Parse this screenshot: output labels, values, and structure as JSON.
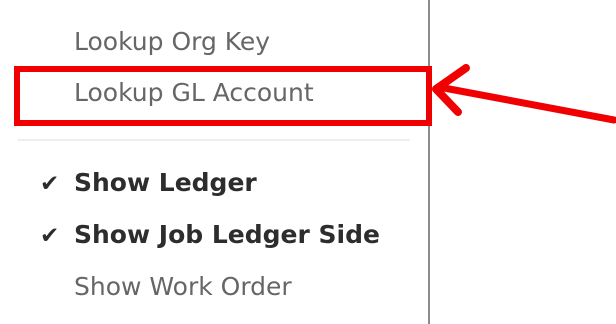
{
  "menu": {
    "items": [
      {
        "label": "Lookup Org Key",
        "checked": false
      },
      {
        "label": "Lookup GL Account",
        "checked": false,
        "highlighted": true
      },
      {
        "label": "Show Ledger",
        "checked": true
      },
      {
        "label": "Show Job Ledger Side",
        "checked": true
      },
      {
        "label": "Show Work Order",
        "checked": false
      }
    ],
    "check_mark": "✔"
  },
  "annotation": {
    "highlight_color": "#f00000",
    "arrow_color": "#f00000"
  }
}
